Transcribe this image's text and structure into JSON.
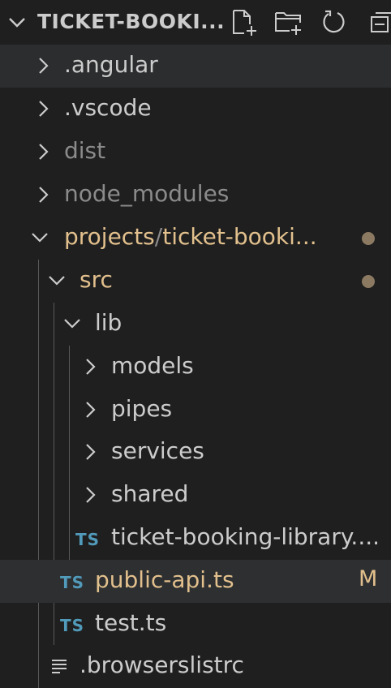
{
  "explorer": {
    "title": "TICKET-BOOKI...",
    "colors": {
      "modified": "#e2c08d",
      "ignored": "#8b8b8b",
      "ts_icon": "#519aba"
    }
  },
  "tree": {
    "angular": ".angular",
    "vscode": ".vscode",
    "dist": "dist",
    "node_modules": "node_modules",
    "projects": "projects",
    "projects_sep": "/",
    "projects_sub": "ticket-booki...",
    "src": "src",
    "lib": "lib",
    "models": "models",
    "pipes": "pipes",
    "services": "services",
    "shared": "shared",
    "lib_file": "ticket-booking-library....",
    "public_api": "public-api.ts",
    "public_api_badge": "M",
    "test": "test.ts",
    "browserslistrc": ".browserslistrc",
    "ts_badge": "TS"
  }
}
